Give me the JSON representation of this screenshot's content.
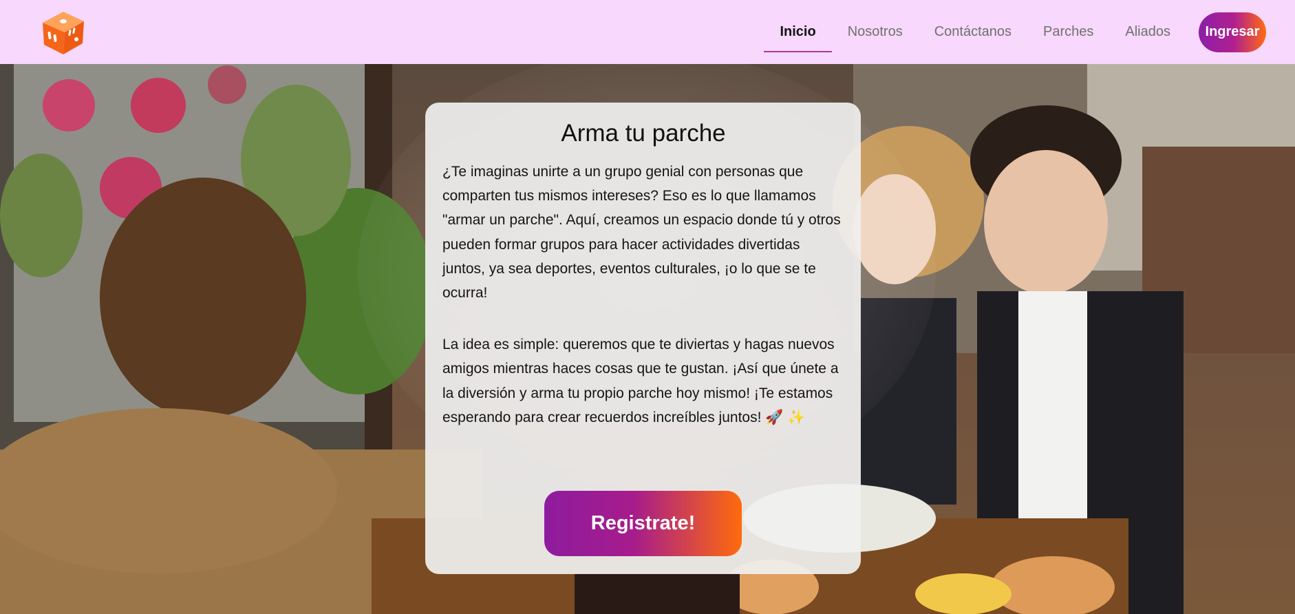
{
  "header": {
    "logo_icon": "dice-logo-icon",
    "nav": [
      {
        "label": "Inicio",
        "active": true
      },
      {
        "label": "Nosotros",
        "active": false
      },
      {
        "label": "Contáctanos",
        "active": false
      },
      {
        "label": "Parches",
        "active": false
      },
      {
        "label": "Aliados",
        "active": false
      }
    ],
    "login_label": "Ingresar"
  },
  "hero": {
    "background": "photo of friends laughing at a restaurant table"
  },
  "card": {
    "title": "Arma tu parche",
    "paragraph_1": "¿Te imaginas unirte a un grupo genial con personas que comparten tus mismos intereses? Eso es lo que llamamos \"armar un parche\". Aquí, creamos un espacio donde tú y otros pueden formar grupos para hacer actividades divertidas juntos, ya sea deportes, eventos culturales, ¡o lo que se te ocurra!",
    "paragraph_2": "La idea es simple: queremos que te diviertas y hagas nuevos amigos mientras haces cosas que te gustan. ¡Así que únete a la diversión y arma tu propio parche hoy mismo! ¡Te estamos esperando para crear recuerdos increíbles juntos! 🚀 ✨",
    "cta_label": "Registrate!"
  },
  "colors": {
    "header_bg": "#f8d8fc",
    "accent_purple": "#8e1c9e",
    "accent_orange": "#ff6b0c",
    "active_underline": "#a43aa6"
  }
}
